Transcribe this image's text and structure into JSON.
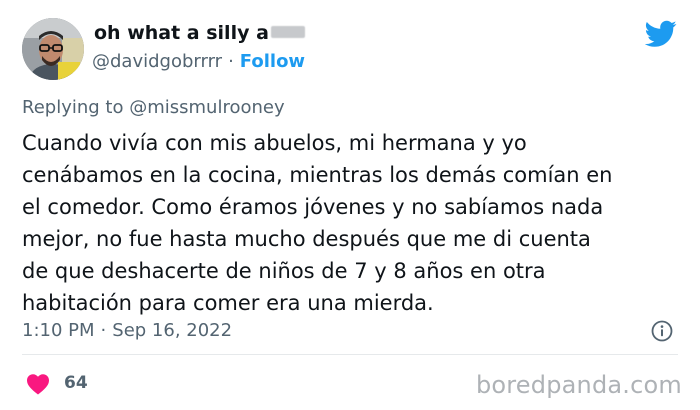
{
  "author": {
    "display_name": "oh what a silly a",
    "handle": "@davidgobrrrr",
    "separator": "·",
    "follow_label": "Follow"
  },
  "reply": {
    "prefix": "Replying to",
    "mention": "@missmulrooney"
  },
  "tweet": {
    "lines": [
      "Cuando vivía con mis abuelos, mi hermana y yo",
      "cenábamos en la cocina, mientras los demás comían en",
      "el comedor. Como éramos jóvenes y no sabíamos nada",
      "mejor, no fue hasta mucho después que me di cuenta",
      "de que deshacerte de niños de 7 y 8 años en otra",
      "habitación para comer era una mierda."
    ],
    "time": "1:10 PM",
    "date": "Sep 16, 2022",
    "likes": "64"
  },
  "icons": {
    "brand": "twitter-bird-icon",
    "info": "info-icon",
    "like": "heart-icon"
  },
  "colors": {
    "twitter_blue": "#1d9bf0",
    "heart": "#f91880",
    "muted_text": "#536471",
    "watermark": "#aeb2b6"
  },
  "watermark": "boredpanda.com"
}
